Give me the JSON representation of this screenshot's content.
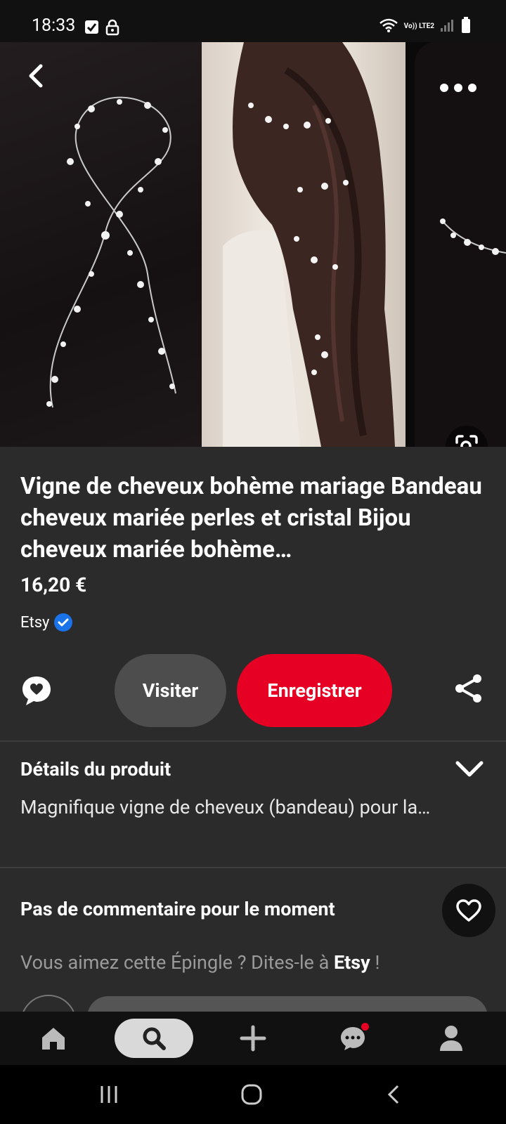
{
  "status_bar": {
    "time": "18:33",
    "network_label": "Vo)) LTE2"
  },
  "icons": {
    "back": "chevron-left-icon",
    "more": "more-dots-icon",
    "visual_search": "lens-icon",
    "comment": "chat-bubble-icon",
    "share": "share-icon",
    "expand": "chevron-down-icon",
    "like": "heart-icon"
  },
  "product": {
    "title": "Vigne de cheveux bohème mariage Bandeau cheveux mariée perles et cristal Bijou cheveux mariée bohème…",
    "price": "16,20 €",
    "seller": "Etsy"
  },
  "actions": {
    "visit_label": "Visiter",
    "save_label": "Enregistrer"
  },
  "details": {
    "title": "Détails du produit",
    "summary": "Magnifique vigne de cheveux (bandeau) pour la…"
  },
  "comments": {
    "title": "Pas de commentaire pour le moment",
    "prompt_prefix": "Vous aimez cette Épingle ? Dites-le à ",
    "prompt_brand": "Etsy",
    "prompt_suffix": " !"
  },
  "bottom_nav": [
    "home-icon",
    "search-icon",
    "create-plus-icon",
    "messages-icon",
    "profile-icon"
  ],
  "system_nav": [
    "recents-icon",
    "home-button-icon",
    "back-icon"
  ],
  "colors": {
    "save_red": "#e60023",
    "background": "#2b2b2b",
    "verified_blue": "#1a73e8"
  }
}
